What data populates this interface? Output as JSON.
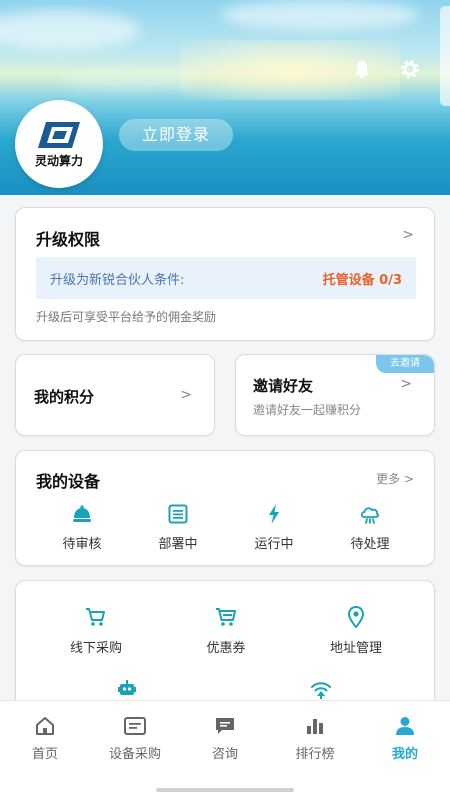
{
  "header": {
    "logo_text": "灵动算力",
    "login_label": "立即登录"
  },
  "upgrade": {
    "title": "升级权限",
    "chevron": ">",
    "condition_label": "升级为新锐合伙人条件:",
    "condition_value": "托管设备 0/3",
    "note": "升级后可享受平台给予的佣金奖励"
  },
  "points": {
    "title": "我的积分",
    "chevron": ">"
  },
  "invite": {
    "badge": "去邀请",
    "title": "邀请好友",
    "subtitle": "邀请好友一起赚积分",
    "chevron": ">"
  },
  "devices": {
    "title": "我的设备",
    "more": "更多 >",
    "items": [
      {
        "label": "待审核",
        "icon": "bell-icon"
      },
      {
        "label": "部署中",
        "icon": "list-icon"
      },
      {
        "label": "运行中",
        "icon": "lightning-icon"
      },
      {
        "label": "待处理",
        "icon": "cloud-tools-icon"
      }
    ]
  },
  "services": {
    "items": [
      {
        "label": "线下采购",
        "icon": "cart-icon"
      },
      {
        "label": "优惠券",
        "icon": "shopping-cart-icon"
      },
      {
        "label": "地址管理",
        "icon": "location-pin-icon"
      },
      {
        "label": "",
        "icon": "robot-icon"
      },
      {
        "label": "",
        "icon": "wifi-upload-icon"
      }
    ]
  },
  "tabbar": {
    "items": [
      {
        "label": "首页",
        "icon": "home-icon"
      },
      {
        "label": "设备采购",
        "icon": "card-icon"
      },
      {
        "label": "咨询",
        "icon": "chat-icon"
      },
      {
        "label": "排行榜",
        "icon": "bar-chart-icon"
      },
      {
        "label": "我的",
        "icon": "user-icon"
      }
    ],
    "active_index": 4
  },
  "colors": {
    "accent": "#27a6d8",
    "orange": "#e8622a",
    "teal": "#1aa3b8"
  }
}
